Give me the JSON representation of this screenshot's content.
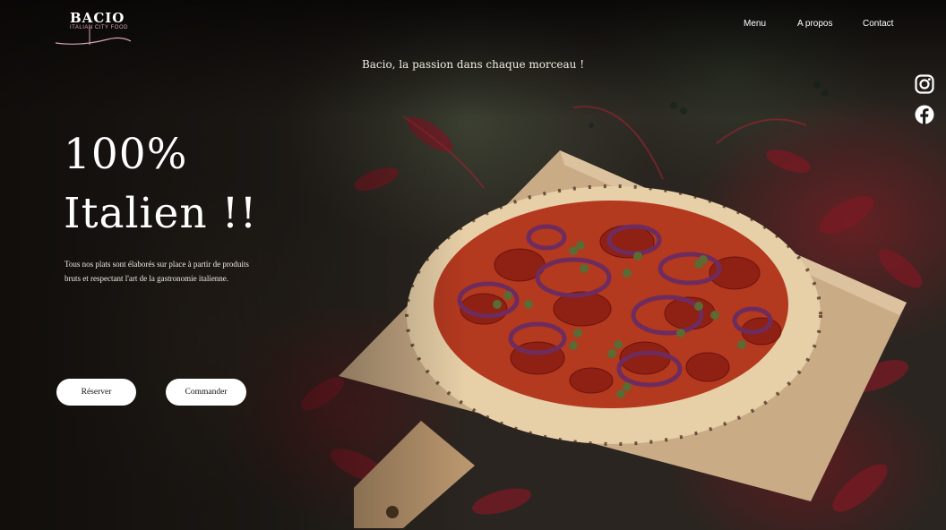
{
  "brand": {
    "name": "BACIO",
    "subtitle": "ITALIAN CITY FOOD"
  },
  "nav": {
    "items": [
      "Menu",
      "A propos",
      "Contact"
    ]
  },
  "tagline": "Bacio, la passion dans chaque morceau !",
  "hero": {
    "title_line1": "100%",
    "title_line2": "Italien !!",
    "description": "Tous nos plats sont élaborés sur place à partir de produits bruts et respectant l'art de la gastronomie italienne."
  },
  "buttons": {
    "reserve": "Réserver",
    "order": "Commander"
  },
  "social": [
    "instagram-icon",
    "facebook-icon"
  ],
  "colors": {
    "accent_pink": "#d6a3b8",
    "button_bg": "#ffffff",
    "background_dark": "#1b1a17"
  }
}
